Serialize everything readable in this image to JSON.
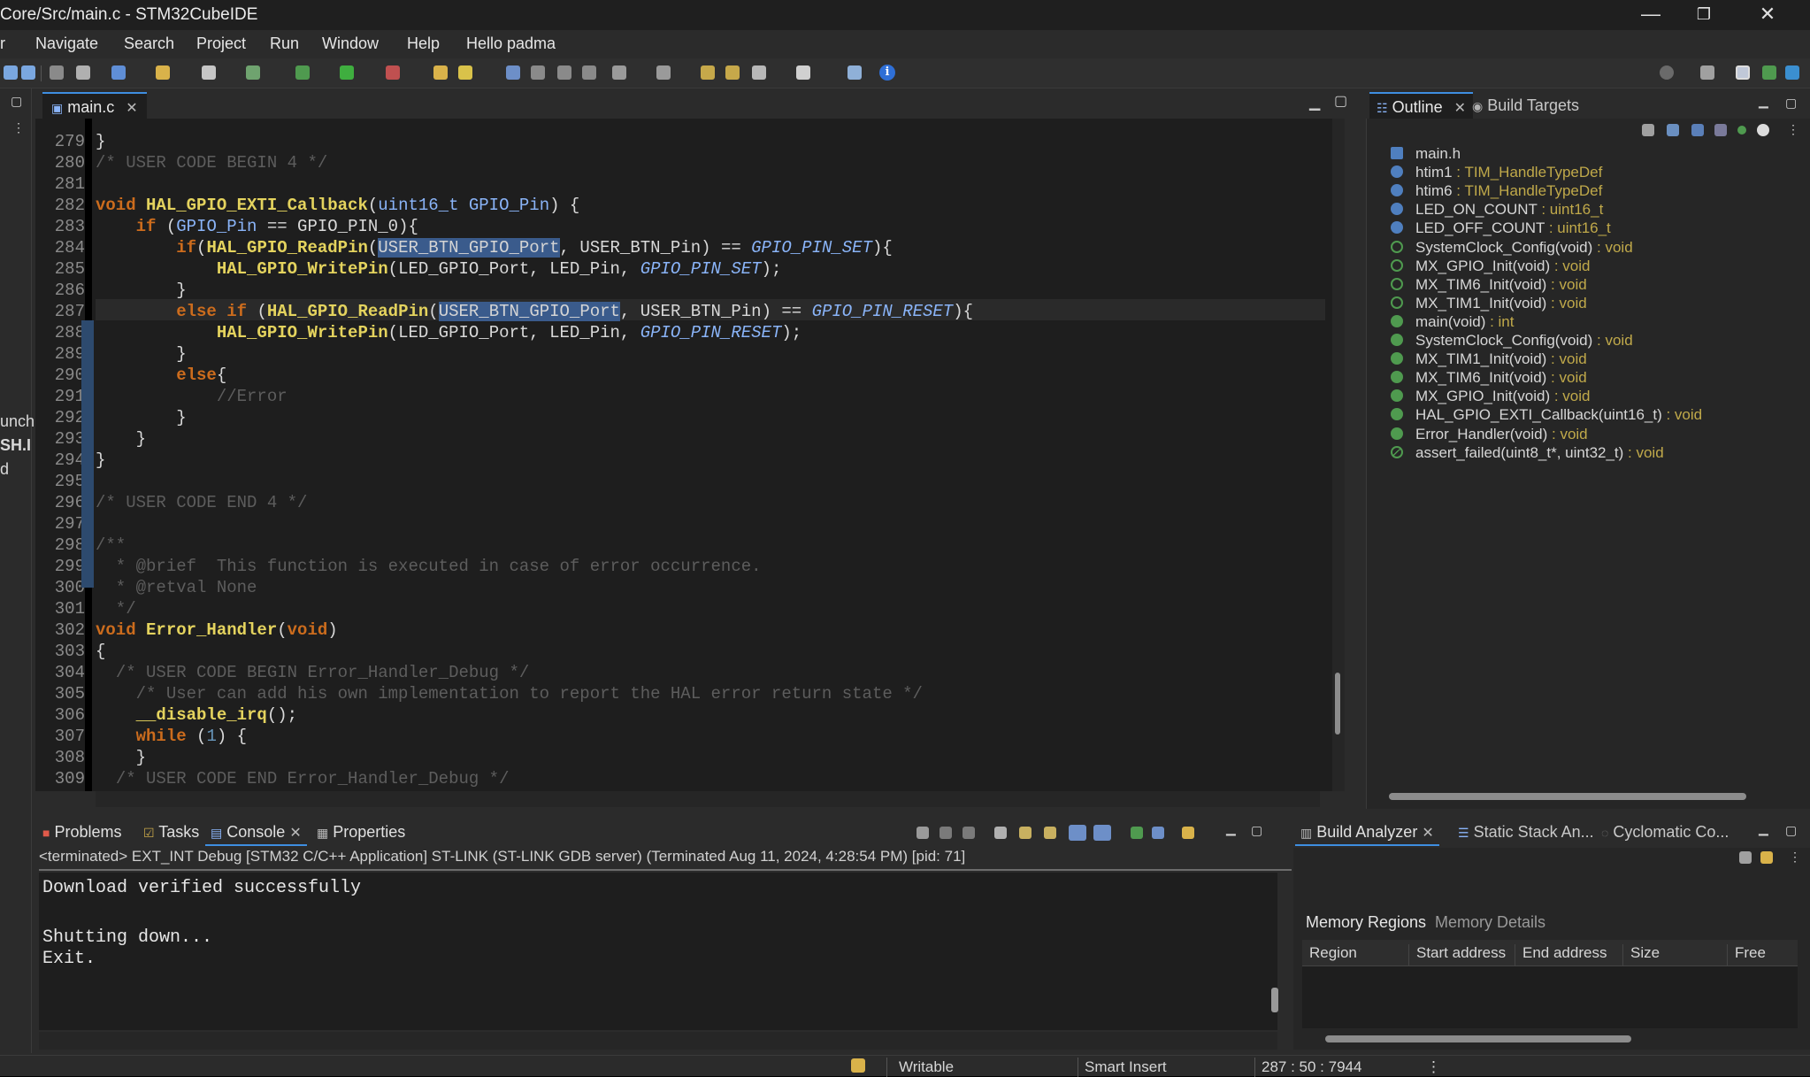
{
  "window": {
    "title": "Core/Src/main.c - STM32CubeIDE",
    "minimize_glyph": "—",
    "maximize_glyph": "❐",
    "close_glyph": "✕"
  },
  "menu": [
    "r",
    "Navigate",
    "Search",
    "Project",
    "Run",
    "Window",
    "Help",
    "Hello padma"
  ],
  "left_strip": [
    "unch",
    "SH.I",
    "d"
  ],
  "editor": {
    "tab_label": "main.c",
    "tab_close": "✕",
    "lines": [
      {
        "n": "279",
        "code": [
          {
            "c": "id",
            "t": "}"
          }
        ]
      },
      {
        "n": "280",
        "code": [
          {
            "c": "cm",
            "t": "/* USER CODE BEGIN 4 */"
          }
        ]
      },
      {
        "n": "281",
        "code": []
      },
      {
        "n": "282",
        "code": [
          {
            "c": "kw",
            "t": "void "
          },
          {
            "c": "fn",
            "t": "HAL_GPIO_EXTI_Callback"
          },
          {
            "c": "id",
            "t": "("
          },
          {
            "c": "ty",
            "t": "uint16_t GPIO_Pin"
          },
          {
            "c": "id",
            "t": ") {"
          }
        ]
      },
      {
        "n": "283",
        "code": [
          {
            "c": "id",
            "t": "    "
          },
          {
            "c": "kw",
            "t": "if"
          },
          {
            "c": "id",
            "t": " ("
          },
          {
            "c": "ty",
            "t": "GPIO_Pin"
          },
          {
            "c": "id",
            "t": " == GPIO_PIN_0){"
          }
        ]
      },
      {
        "n": "284",
        "code": [
          {
            "c": "id",
            "t": "        "
          },
          {
            "c": "kw",
            "t": "if"
          },
          {
            "c": "id",
            "t": "("
          },
          {
            "c": "fn",
            "t": "HAL_GPIO_ReadPin"
          },
          {
            "c": "id",
            "t": "("
          },
          {
            "c": "hl",
            "t": "USER_BTN_GPIO_Port"
          },
          {
            "c": "id",
            "t": ", USER_BTN_Pin) == "
          },
          {
            "c": "mc",
            "t": "GPIO_PIN_SET"
          },
          {
            "c": "id",
            "t": "){"
          }
        ]
      },
      {
        "n": "285",
        "code": [
          {
            "c": "id",
            "t": "            "
          },
          {
            "c": "fn",
            "t": "HAL_GPIO_WritePin"
          },
          {
            "c": "id",
            "t": "(LED_GPIO_Port, LED_Pin, "
          },
          {
            "c": "mc",
            "t": "GPIO_PIN_SET"
          },
          {
            "c": "id",
            "t": ");"
          }
        ]
      },
      {
        "n": "286",
        "code": [
          {
            "c": "id",
            "t": "        }"
          }
        ]
      },
      {
        "n": "287",
        "code": [
          {
            "c": "id",
            "t": "        "
          },
          {
            "c": "kw",
            "t": "else if"
          },
          {
            "c": "id",
            "t": " ("
          },
          {
            "c": "fn",
            "t": "HAL_GPIO_ReadPin"
          },
          {
            "c": "id",
            "t": "("
          },
          {
            "c": "hl",
            "t": "USER_BTN_GPIO_Port"
          },
          {
            "c": "id",
            "t": ", USER_BTN_Pin) == "
          },
          {
            "c": "mc",
            "t": "GPIO_PIN_RESET"
          },
          {
            "c": "id",
            "t": "){"
          }
        ]
      },
      {
        "n": "288",
        "code": [
          {
            "c": "id",
            "t": "            "
          },
          {
            "c": "fn",
            "t": "HAL_GPIO_WritePin"
          },
          {
            "c": "id",
            "t": "(LED_GPIO_Port, LED_Pin, "
          },
          {
            "c": "mc",
            "t": "GPIO_PIN_RESET"
          },
          {
            "c": "id",
            "t": ");"
          }
        ]
      },
      {
        "n": "289",
        "code": [
          {
            "c": "id",
            "t": "        }"
          }
        ]
      },
      {
        "n": "290",
        "code": [
          {
            "c": "id",
            "t": "        "
          },
          {
            "c": "kw",
            "t": "else"
          },
          {
            "c": "id",
            "t": "{"
          }
        ]
      },
      {
        "n": "291",
        "code": [
          {
            "c": "id",
            "t": "            "
          },
          {
            "c": "cm",
            "t": "//Error"
          }
        ]
      },
      {
        "n": "292",
        "code": [
          {
            "c": "id",
            "t": "        }"
          }
        ]
      },
      {
        "n": "293",
        "code": [
          {
            "c": "id",
            "t": "    }"
          }
        ]
      },
      {
        "n": "294",
        "code": [
          {
            "c": "id",
            "t": "}"
          }
        ]
      },
      {
        "n": "295",
        "code": []
      },
      {
        "n": "296",
        "code": [
          {
            "c": "cm",
            "t": "/* USER CODE END 4 */"
          }
        ]
      },
      {
        "n": "297",
        "code": []
      },
      {
        "n": "298",
        "code": [
          {
            "c": "cm",
            "t": "/**"
          }
        ]
      },
      {
        "n": "299",
        "code": [
          {
            "c": "cm",
            "t": "  * @brief  This function is executed in case of error occurrence."
          }
        ]
      },
      {
        "n": "300",
        "code": [
          {
            "c": "cm",
            "t": "  * @retval None"
          }
        ]
      },
      {
        "n": "301",
        "code": [
          {
            "c": "cm",
            "t": "  */"
          }
        ]
      },
      {
        "n": "302",
        "code": [
          {
            "c": "kw",
            "t": "void "
          },
          {
            "c": "fn",
            "t": "Error_Handler"
          },
          {
            "c": "id",
            "t": "("
          },
          {
            "c": "kw",
            "t": "void"
          },
          {
            "c": "id",
            "t": ")"
          }
        ]
      },
      {
        "n": "303",
        "code": [
          {
            "c": "id",
            "t": "{"
          }
        ]
      },
      {
        "n": "304",
        "code": [
          {
            "c": "id",
            "t": "  "
          },
          {
            "c": "cm",
            "t": "/* USER CODE BEGIN Error_Handler_Debug */"
          }
        ]
      },
      {
        "n": "305",
        "code": [
          {
            "c": "id",
            "t": "    "
          },
          {
            "c": "cm",
            "t": "/* User can add his own implementation to report the HAL error return state */"
          }
        ]
      },
      {
        "n": "306",
        "code": [
          {
            "c": "id",
            "t": "    "
          },
          {
            "c": "fn",
            "t": "__disable_irq"
          },
          {
            "c": "id",
            "t": "();"
          }
        ]
      },
      {
        "n": "307",
        "code": [
          {
            "c": "id",
            "t": "    "
          },
          {
            "c": "kw",
            "t": "while"
          },
          {
            "c": "id",
            "t": " ("
          },
          {
            "c": "nu",
            "t": "1"
          },
          {
            "c": "id",
            "t": ") {"
          }
        ]
      },
      {
        "n": "308",
        "code": [
          {
            "c": "id",
            "t": "    }"
          }
        ]
      },
      {
        "n": "309",
        "code": [
          {
            "c": "id",
            "t": "  "
          },
          {
            "c": "cm",
            "t": "/* USER CODE END Error_Handler_Debug */"
          }
        ]
      }
    ]
  },
  "outline": {
    "tab_label": "Outline",
    "tab2_label": "Build Targets",
    "close": "✕",
    "items": [
      {
        "name": "main.h",
        "type": "",
        "icon": "#4f7fbf",
        "shape": "square"
      },
      {
        "name": "htim1",
        "type": " : TIM_HandleTypeDef",
        "icon": "#4f7fbf",
        "shape": "circle"
      },
      {
        "name": "htim6",
        "type": " : TIM_HandleTypeDef",
        "icon": "#4f7fbf",
        "shape": "circle"
      },
      {
        "name": "LED_ON_COUNT",
        "type": " : uint16_t",
        "icon": "#4f7fbf",
        "shape": "circle"
      },
      {
        "name": "LED_OFF_COUNT",
        "type": " : uint16_t",
        "icon": "#4f7fbf",
        "shape": "circle"
      },
      {
        "name": "SystemClock_Config(void)",
        "type": " : void",
        "icon": "#4f9a4f",
        "shape": "ring"
      },
      {
        "name": "MX_GPIO_Init(void)",
        "type": " : void",
        "icon": "#4f9a4f",
        "shape": "ring"
      },
      {
        "name": "MX_TIM6_Init(void)",
        "type": " : void",
        "icon": "#4f9a4f",
        "shape": "ring"
      },
      {
        "name": "MX_TIM1_Init(void)",
        "type": " : void",
        "icon": "#4f9a4f",
        "shape": "ring"
      },
      {
        "name": "main(void)",
        "type": " : int",
        "icon": "#4f9a4f",
        "shape": "circle"
      },
      {
        "name": "SystemClock_Config(void)",
        "type": " : void",
        "icon": "#4f9a4f",
        "shape": "circle"
      },
      {
        "name": "MX_TIM1_Init(void)",
        "type": " : void",
        "icon": "#4f9a4f",
        "shape": "circle"
      },
      {
        "name": "MX_TIM6_Init(void)",
        "type": " : void",
        "icon": "#4f9a4f",
        "shape": "circle"
      },
      {
        "name": "MX_GPIO_Init(void)",
        "type": " : void",
        "icon": "#4f9a4f",
        "shape": "circle"
      },
      {
        "name": "HAL_GPIO_EXTI_Callback(uint16_t)",
        "type": " : void",
        "icon": "#4f9a4f",
        "shape": "circle"
      },
      {
        "name": "Error_Handler(void)",
        "type": " : void",
        "icon": "#4f9a4f",
        "shape": "circle"
      },
      {
        "name": "assert_failed(uint8_t*, uint32_t)",
        "type": " : void",
        "icon": "#4f9a4f",
        "shape": "slash"
      }
    ]
  },
  "console": {
    "tabs": {
      "problems": "Problems",
      "tasks": "Tasks",
      "console": "Console",
      "properties": "Properties"
    },
    "close": "✕",
    "status": "<terminated> EXT_INT Debug [STM32 C/C++ Application] ST-LINK (ST-LINK GDB server) (Terminated Aug 11, 2024, 4:28:54 PM) [pid: 71]",
    "line1": "Download verified successfully",
    "line2": "Shutting down...",
    "line3": "Exit."
  },
  "build_analyzer": {
    "tab_label": "Build Analyzer",
    "tab2_label": "Static Stack An...",
    "tab3_label": "Cyclomatic Co...",
    "close": "✕",
    "sub_memory_regions": "Memory Regions",
    "sub_memory_details": "Memory Details",
    "columns": [
      "Region",
      "Start address",
      "End address",
      "Size",
      "Free"
    ]
  },
  "statusbar": {
    "writable": "Writable",
    "insert_mode": "Smart Insert",
    "position": "287 : 50 : 7944"
  }
}
